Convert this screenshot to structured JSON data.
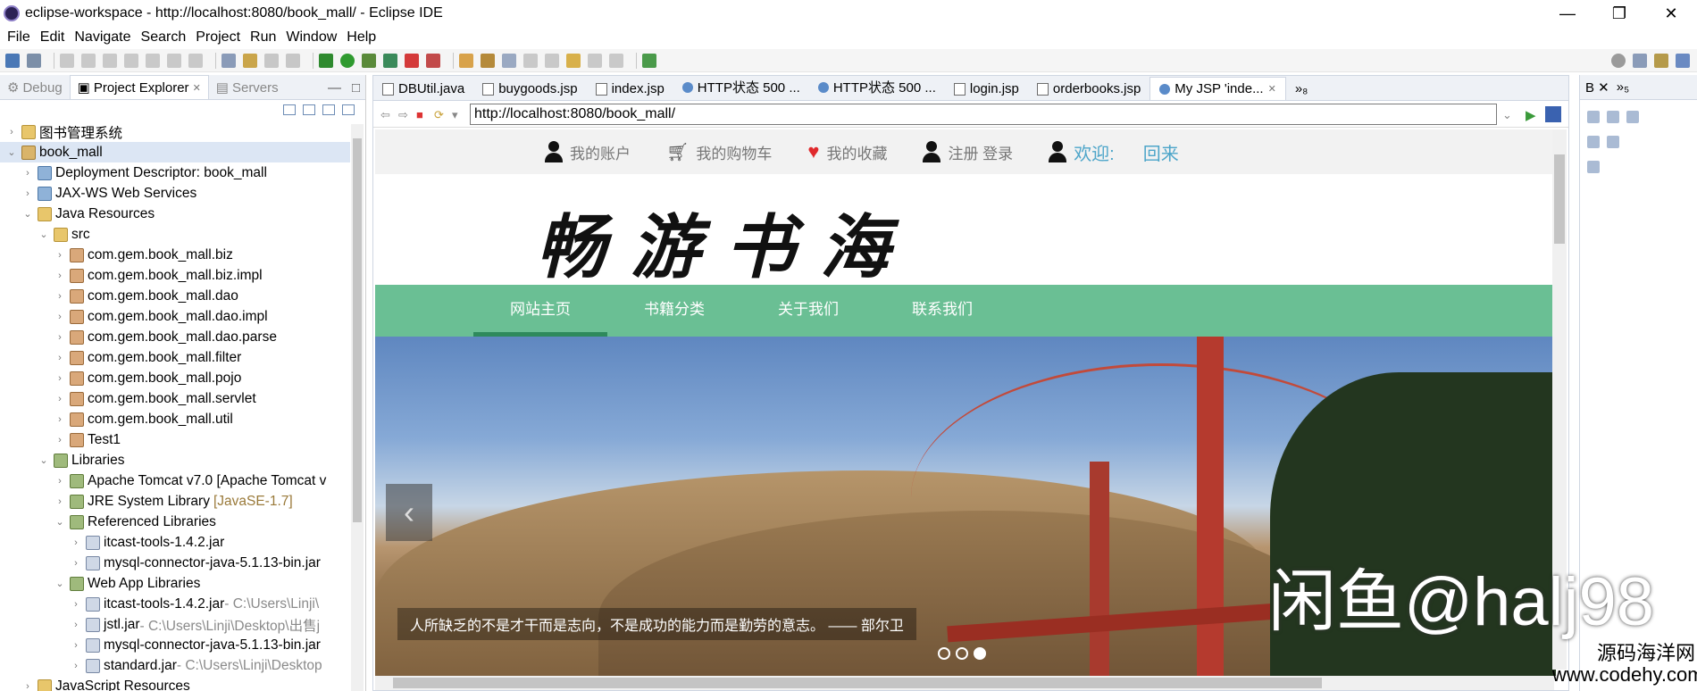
{
  "window": {
    "title": "eclipse-workspace - http://localhost:8080/book_mall/ - Eclipse IDE",
    "minimize": "—",
    "restore": "❐",
    "close": "✕"
  },
  "menu": [
    "File",
    "Edit",
    "Navigate",
    "Search",
    "Project",
    "Run",
    "Window",
    "Help"
  ],
  "left_panel": {
    "tabs": [
      {
        "label": "Debug",
        "active": false
      },
      {
        "label": "Project Explorer",
        "active": true,
        "close": "✕"
      },
      {
        "label": "Servers",
        "active": false
      }
    ],
    "tree": [
      {
        "indent": 0,
        "arrow": "›",
        "icon": "folder",
        "label": "图书管理系统"
      },
      {
        "indent": 0,
        "arrow": "⌄",
        "icon": "project",
        "label": "book_mall",
        "selected": true
      },
      {
        "indent": 1,
        "arrow": "›",
        "icon": "web",
        "label": "Deployment Descriptor: book_mall"
      },
      {
        "indent": 1,
        "arrow": "›",
        "icon": "web",
        "label": "JAX-WS Web Services"
      },
      {
        "indent": 1,
        "arrow": "⌄",
        "icon": "folder",
        "label": "Java Resources"
      },
      {
        "indent": 2,
        "arrow": "⌄",
        "icon": "folder",
        "label": "src"
      },
      {
        "indent": 3,
        "arrow": "›",
        "icon": "pkg",
        "label": "com.gem.book_mall.biz"
      },
      {
        "indent": 3,
        "arrow": "›",
        "icon": "pkg",
        "label": "com.gem.book_mall.biz.impl"
      },
      {
        "indent": 3,
        "arrow": "›",
        "icon": "pkg",
        "label": "com.gem.book_mall.dao"
      },
      {
        "indent": 3,
        "arrow": "›",
        "icon": "pkg",
        "label": "com.gem.book_mall.dao.impl"
      },
      {
        "indent": 3,
        "arrow": "›",
        "icon": "pkg",
        "label": "com.gem.book_mall.dao.parse"
      },
      {
        "indent": 3,
        "arrow": "›",
        "icon": "pkg",
        "label": "com.gem.book_mall.filter"
      },
      {
        "indent": 3,
        "arrow": "›",
        "icon": "pkg",
        "label": "com.gem.book_mall.pojo"
      },
      {
        "indent": 3,
        "arrow": "›",
        "icon": "pkg",
        "label": "com.gem.book_mall.servlet"
      },
      {
        "indent": 3,
        "arrow": "›",
        "icon": "pkg",
        "label": "com.gem.book_mall.util"
      },
      {
        "indent": 3,
        "arrow": "›",
        "icon": "pkg",
        "label": "Test1"
      },
      {
        "indent": 2,
        "arrow": "⌄",
        "icon": "lib",
        "label": "Libraries"
      },
      {
        "indent": 3,
        "arrow": "›",
        "icon": "lib",
        "label": "Apache Tomcat v7.0 [Apache Tomcat v"
      },
      {
        "indent": 3,
        "arrow": "›",
        "icon": "lib",
        "label": "JRE System Library",
        "suffix": "[JavaSE-1.7]"
      },
      {
        "indent": 3,
        "arrow": "⌄",
        "icon": "lib",
        "label": "Referenced Libraries"
      },
      {
        "indent": 4,
        "arrow": "›",
        "icon": "jar",
        "label": "itcast-tools-1.4.2.jar"
      },
      {
        "indent": 4,
        "arrow": "›",
        "icon": "jar",
        "label": "mysql-connector-java-5.1.13-bin.jar"
      },
      {
        "indent": 3,
        "arrow": "⌄",
        "icon": "lib",
        "label": "Web App Libraries"
      },
      {
        "indent": 4,
        "arrow": "›",
        "icon": "jar",
        "label": "itcast-tools-1.4.2.jar",
        "dim": " - C:\\Users\\Linji\\"
      },
      {
        "indent": 4,
        "arrow": "›",
        "icon": "jar",
        "label": "jstl.jar",
        "dim": " - C:\\Users\\Linji\\Desktop\\出售j"
      },
      {
        "indent": 4,
        "arrow": "›",
        "icon": "jar",
        "label": "mysql-connector-java-5.1.13-bin.jar"
      },
      {
        "indent": 4,
        "arrow": "›",
        "icon": "jar",
        "label": "standard.jar",
        "dim": " - C:\\Users\\Linji\\Desktop"
      },
      {
        "indent": 1,
        "arrow": "›",
        "icon": "folder",
        "label": "JavaScript Resources"
      }
    ]
  },
  "editor": {
    "tabs": [
      {
        "label": "DBUtil.java",
        "icon": "file"
      },
      {
        "label": "buygoods.jsp",
        "icon": "file"
      },
      {
        "label": "index.jsp",
        "icon": "file"
      },
      {
        "label": "HTTP状态 500 ...",
        "icon": "globe"
      },
      {
        "label": "HTTP状态 500 ...",
        "icon": "globe"
      },
      {
        "label": "login.jsp",
        "icon": "file"
      },
      {
        "label": "orderbooks.jsp",
        "icon": "file"
      },
      {
        "label": "My JSP 'inde...",
        "icon": "globe",
        "active": true,
        "close": "✕"
      }
    ],
    "overflow": "»₈",
    "url": "http://localhost:8080/book_mall/"
  },
  "site": {
    "top_links": [
      {
        "icon": "user-icon",
        "label": "我的账户"
      },
      {
        "icon": "cart-icon",
        "label": "我的购物车"
      },
      {
        "icon": "heart-icon",
        "label": "我的收藏"
      },
      {
        "icon": "user-icon",
        "label": "注册 登录"
      }
    ],
    "welcome": "欢迎:",
    "welcome_name": "回来",
    "logo": "畅游书海",
    "nav": [
      {
        "label": "网站主页",
        "active": true
      },
      {
        "label": "书籍分类"
      },
      {
        "label": "关于我们"
      },
      {
        "label": "联系我们"
      }
    ],
    "banner_caption": "人所缺乏的不是才干而是志向，不是成功的能力而是勤劳的意志。 —— 部尔卫",
    "prev_arrow": "‹",
    "slides_total": 3,
    "slide_active": 3
  },
  "watermark": "闲鱼@halj98",
  "watermark_site": "源码海洋网\nwww.codehy.com",
  "colors": {
    "nav_green": "#6abf94",
    "welcome_blue": "#4da5c9",
    "heart_red": "#e0292c"
  }
}
